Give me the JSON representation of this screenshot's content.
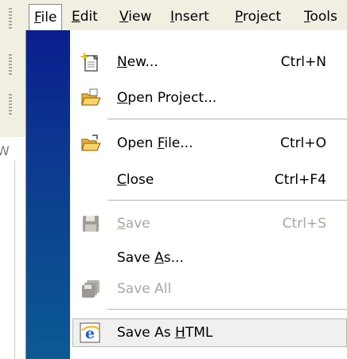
{
  "menubar": {
    "items": [
      {
        "label_pre": "",
        "accel": "F",
        "label_post": "ile"
      },
      {
        "label_pre": "",
        "accel": "E",
        "label_post": "dit"
      },
      {
        "label_pre": "",
        "accel": "V",
        "label_post": "iew"
      },
      {
        "label_pre": "",
        "accel": "I",
        "label_post": "nsert"
      },
      {
        "label_pre": "",
        "accel": "P",
        "label_post": "roject"
      },
      {
        "label_pre": "",
        "accel": "T",
        "label_post": "ools"
      }
    ]
  },
  "left_panel": {
    "tab_letter": "W"
  },
  "file_menu": {
    "items": [
      {
        "label_pre": "",
        "accel": "N",
        "label_post": "ew...",
        "shortcut": "Ctrl+N",
        "icon": "new-document-icon",
        "enabled": true
      },
      {
        "label_pre": "",
        "accel": "O",
        "label_post": "pen Project...",
        "shortcut": "",
        "icon": "open-project-folder-icon",
        "enabled": true
      },
      {
        "label_pre": "Open ",
        "accel": "F",
        "label_post": "ile...",
        "shortcut": "Ctrl+O",
        "icon": "open-file-folder-icon",
        "enabled": true
      },
      {
        "label_pre": "",
        "accel": "C",
        "label_post": "lose",
        "shortcut": "Ctrl+F4",
        "icon": "",
        "enabled": true
      },
      {
        "label_pre": "",
        "accel": "S",
        "label_post": "ave",
        "shortcut": "Ctrl+S",
        "icon": "save-disk-icon",
        "enabled": false
      },
      {
        "label_pre": "Save ",
        "accel": "A",
        "label_post": "s...",
        "shortcut": "",
        "icon": "",
        "enabled": true
      },
      {
        "label_pre": "Save All",
        "accel": "",
        "label_post": "",
        "shortcut": "",
        "icon": "save-all-icon",
        "enabled": false
      },
      {
        "label_pre": "Save As ",
        "accel": "H",
        "label_post": "TML",
        "shortcut": "",
        "icon": "internet-explorer-icon",
        "enabled": true
      }
    ]
  },
  "colors": {
    "gutter_top": "#0a1e8e",
    "gutter_bottom": "#0b5a92",
    "disabled_text": "#a9a79d"
  }
}
